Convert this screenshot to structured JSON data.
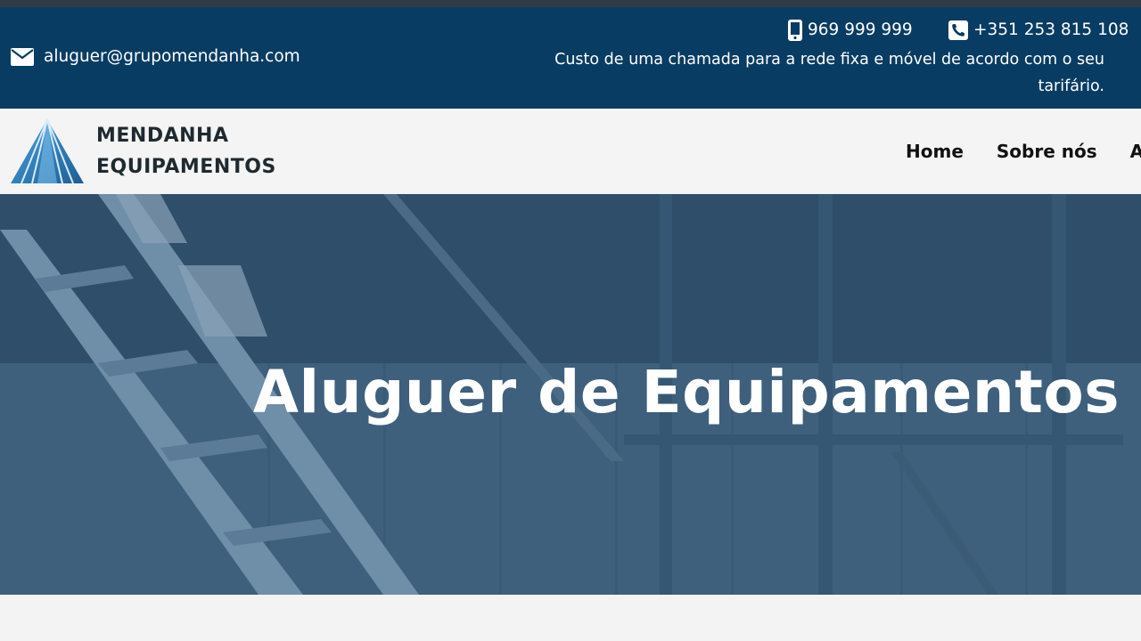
{
  "contact": {
    "email": "aluguer@grupomendanha.com",
    "email_icon": "envelope-icon",
    "mobile": "969 999 999",
    "mobile_icon": "mobile-phone-icon",
    "landline": "+351 253 815 108",
    "landline_icon": "phone-icon",
    "call_note": "Custo de uma chamada para a rede fixa e móvel de acordo com o seu tarifário."
  },
  "brand": {
    "line1": "MENDANHA",
    "line2": "EQUIPAMENTOS",
    "logo_icon": "pyramid-logo-icon"
  },
  "nav": {
    "items": [
      {
        "label": "Home"
      },
      {
        "label": "Sobre nós"
      },
      {
        "label": "A"
      }
    ]
  },
  "hero": {
    "title": "Aluguer de Equipamentos"
  },
  "colors": {
    "info_bar": "#083c63",
    "hero_overlay": "#2b4d6a",
    "header_bg": "#f4f4f4",
    "logo_blue": "#2f7fc0"
  }
}
